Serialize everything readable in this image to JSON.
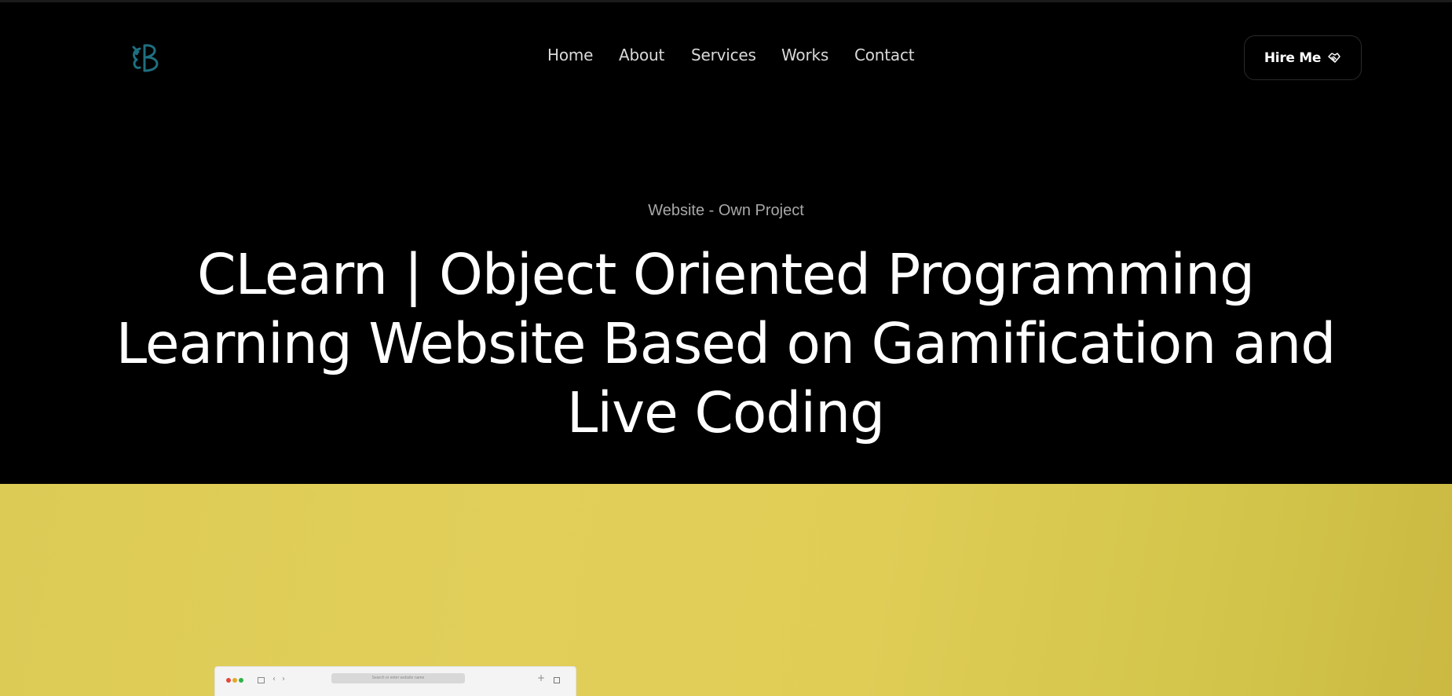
{
  "header": {
    "logo_icon": "stylized-b-logo-icon",
    "nav": [
      {
        "label": "Home"
      },
      {
        "label": "About"
      },
      {
        "label": "Services"
      },
      {
        "label": "Works"
      },
      {
        "label": "Contact"
      }
    ],
    "hire_button": {
      "label": "Hire Me",
      "icon": "handshake-icon"
    }
  },
  "hero": {
    "subtitle": "Website - Own Project",
    "title": "CLearn | Object Oriented Programming Learning Website Based on Gamification and Live Coding"
  },
  "preview": {
    "url_placeholder": "Search or enter website name"
  },
  "colors": {
    "background": "#000000",
    "accent_yellow": "#dccb55",
    "logo_teal": "#1e6f80"
  }
}
